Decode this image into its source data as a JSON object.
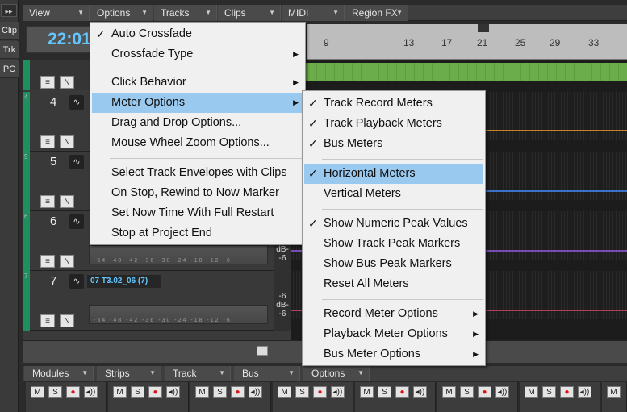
{
  "left_rail": {
    "top_label": "▸▸",
    "buttons": [
      "Clip",
      "Trk",
      "PC"
    ]
  },
  "top_menus": [
    {
      "label": "View"
    },
    {
      "label": "Options"
    },
    {
      "label": "Tracks"
    },
    {
      "label": "Clips"
    },
    {
      "label": "MIDI"
    },
    {
      "label": "Region FX"
    }
  ],
  "now_time": "22:01",
  "ruler_ticks": [
    "9",
    "13",
    "17",
    "21",
    "25",
    "29",
    "33"
  ],
  "tracks": [
    {
      "index": "4",
      "number": "4",
      "name": "",
      "db": []
    },
    {
      "index": "5",
      "number": "5",
      "name": "",
      "db": []
    },
    {
      "index": "6",
      "number": "6",
      "name": "",
      "db": [
        "dB-",
        "-6"
      ]
    },
    {
      "index": "7",
      "number": "7",
      "name": "07 T3.02_06 (7)",
      "db": [
        "-6",
        "dB-",
        "-6"
      ]
    }
  ],
  "meter_scale": "-54 -48 -42 -36 -30 -24 -18 -12 -6",
  "console_menus": [
    {
      "label": "Modules"
    },
    {
      "label": "Strips"
    },
    {
      "label": "Track"
    },
    {
      "label": "Bus"
    },
    {
      "label": "Options"
    }
  ],
  "strip_buttons": {
    "mute": "M",
    "solo": "S",
    "rec": "●",
    "echo": "◂))"
  },
  "options_menu": {
    "items": [
      {
        "label": "Auto Crossfade",
        "checked": true,
        "submenu": false
      },
      {
        "label": "Crossfade Type",
        "checked": false,
        "submenu": true
      },
      {
        "label": "Click Behavior",
        "checked": false,
        "submenu": true
      },
      {
        "label": "Meter Options",
        "checked": false,
        "submenu": true,
        "highlighted": true
      },
      {
        "label": "Drag and Drop Options...",
        "checked": false,
        "submenu": false
      },
      {
        "label": "Mouse Wheel Zoom Options...",
        "checked": false,
        "submenu": false
      },
      {
        "label": "Select Track Envelopes with Clips",
        "checked": false,
        "submenu": false
      },
      {
        "label": "On Stop, Rewind to Now Marker",
        "checked": false,
        "submenu": false
      },
      {
        "label": "Set Now Time With Full Restart",
        "checked": false,
        "submenu": false
      },
      {
        "label": "Stop at Project End",
        "checked": false,
        "submenu": false
      }
    ]
  },
  "meter_submenu": {
    "items": [
      {
        "label": "Track Record Meters",
        "checked": true
      },
      {
        "label": "Track Playback Meters",
        "checked": true
      },
      {
        "label": "Bus Meters",
        "checked": true
      },
      {
        "label": "Horizontal Meters",
        "checked": true,
        "highlighted": true
      },
      {
        "label": "Vertical Meters",
        "checked": false
      },
      {
        "label": "Show Numeric Peak Values",
        "checked": true
      },
      {
        "label": "Show Track Peak Markers",
        "checked": false
      },
      {
        "label": "Show Bus Peak Markers",
        "checked": false
      },
      {
        "label": "Reset All Meters",
        "checked": false
      },
      {
        "label": "Record Meter Options",
        "checked": false,
        "submenu": true
      },
      {
        "label": "Playback Meter Options",
        "checked": false,
        "submenu": true
      },
      {
        "label": "Bus Meter Options",
        "checked": false,
        "submenu": true
      }
    ]
  },
  "glyphs": {
    "check": "✓",
    "submenu_arrow": "▶",
    "dropdown_arrow": "▼"
  },
  "colors": {
    "accent_blue": "#63c6ff",
    "menu_highlight": "#99c9ef",
    "track_green": "#1f8f5f",
    "clip_green": "#6aad4a"
  }
}
